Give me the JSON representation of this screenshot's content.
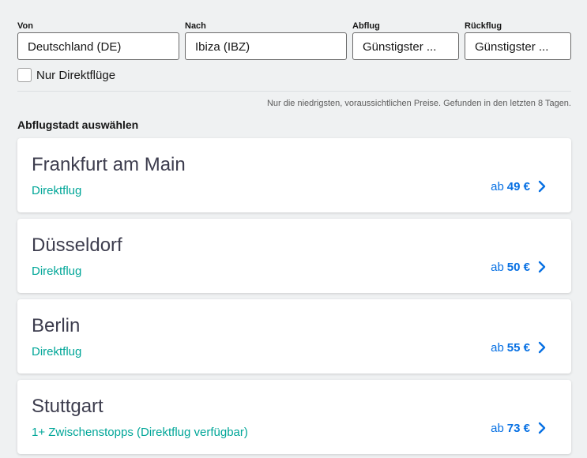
{
  "search": {
    "from": {
      "label": "Von",
      "value": "Deutschland (DE)"
    },
    "to": {
      "label": "Nach",
      "value": "Ibiza (IBZ)"
    },
    "depart": {
      "label": "Abflug",
      "value": "Günstigster ..."
    },
    "return": {
      "label": "Rückflug",
      "value": "Günstigster ..."
    },
    "direct_only": {
      "label": "Nur Direktflüge",
      "checked": false
    }
  },
  "note": "Nur die niedrigsten, voraussichtlichen Preise. Gefunden in den letzten 8 Tagen.",
  "section_title": "Abflugstadt auswählen",
  "cities": [
    {
      "name": "Frankfurt am Main",
      "stops": "Direktflug",
      "price_prefix": "ab",
      "price": "49 €"
    },
    {
      "name": "Düsseldorf",
      "stops": "Direktflug",
      "price_prefix": "ab",
      "price": "50 €"
    },
    {
      "name": "Berlin",
      "stops": "Direktflug",
      "price_prefix": "ab",
      "price": "55 €"
    },
    {
      "name": "Stuttgart",
      "stops": "1+ Zwischenstopps (Direktflug verfügbar)",
      "price_prefix": "ab",
      "price": "73 €"
    }
  ],
  "colors": {
    "background": "#eff1f2",
    "accent_price": "#0770e3",
    "direct_green": "#00a698"
  },
  "icons": {
    "card_arrow": "chevron-right-icon"
  }
}
